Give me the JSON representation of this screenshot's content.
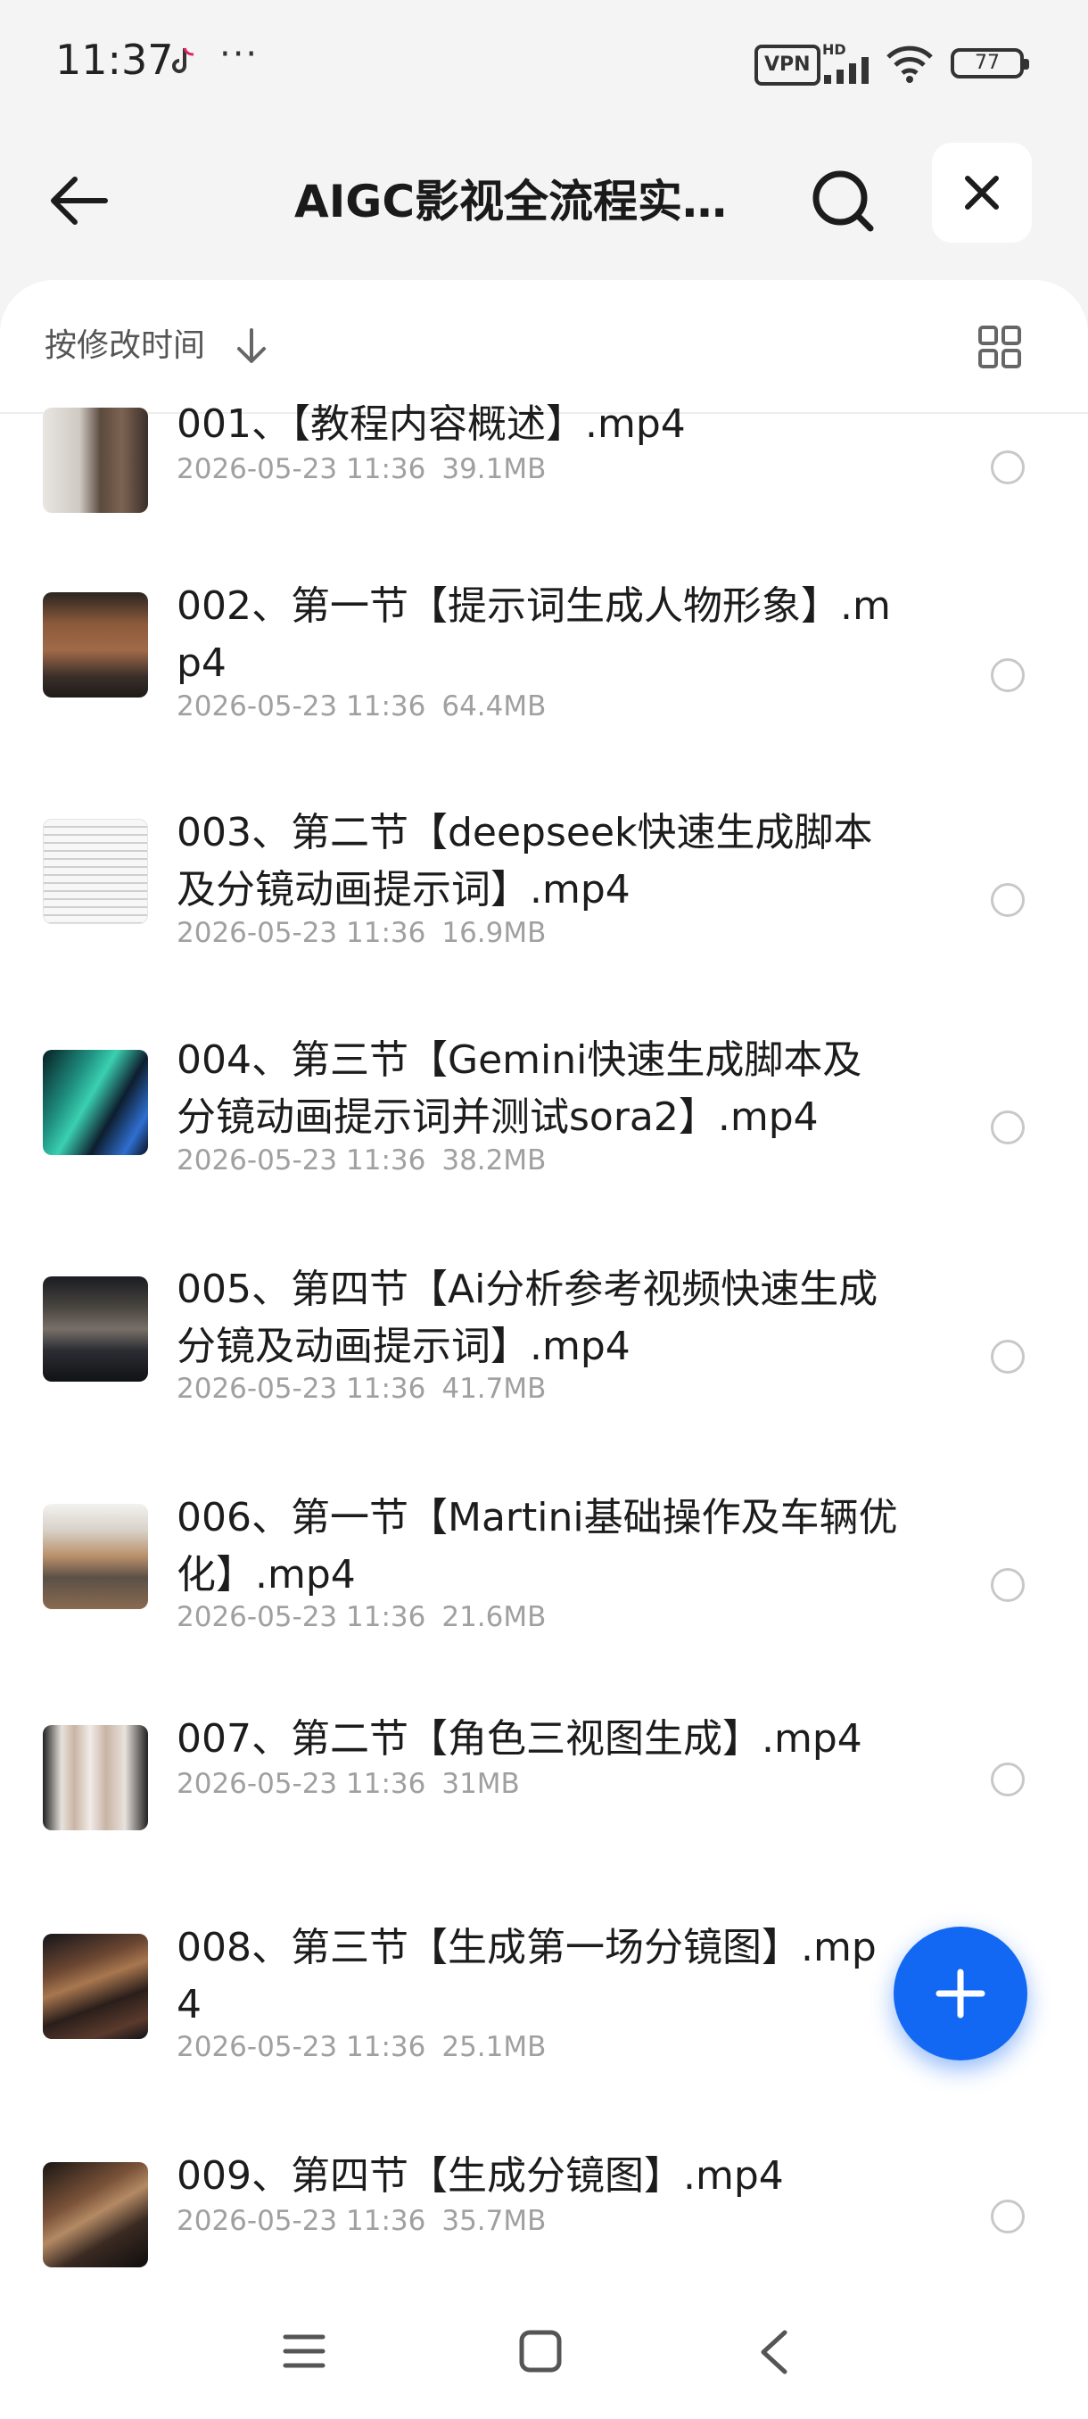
{
  "status_bar": {
    "time": "11:37",
    "more": "···",
    "vpn": "VPN",
    "network": "HD",
    "battery": "77"
  },
  "header": {
    "title": "AIGC影视全流程实…"
  },
  "sort": {
    "label": "按修改时间"
  },
  "files": [
    {
      "name": "001、【教程内容概述】.mp4",
      "date": "2026-05-23 11:36",
      "size": "39.1MB"
    },
    {
      "name": "002、第一节【提示词生成人物形象】.mp4",
      "date": "2026-05-23 11:36",
      "size": "64.4MB"
    },
    {
      "name": "003、第二节【deepseek快速生成脚本及分镜动画提示词】.mp4",
      "date": "2026-05-23 11:36",
      "size": "16.9MB"
    },
    {
      "name": "004、第三节【Gemini快速生成脚本及分镜动画提示词并测试sora2】.mp4",
      "date": "2026-05-23 11:36",
      "size": "38.2MB"
    },
    {
      "name": "005、第四节【Ai分析参考视频快速生成分镜及动画提示词】.mp4",
      "date": "2026-05-23 11:36",
      "size": "41.7MB"
    },
    {
      "name": "006、第一节【Martini基础操作及车辆优化】.mp4",
      "date": "2026-05-23 11:36",
      "size": "21.6MB"
    },
    {
      "name": "007、第二节【角色三视图生成】.mp4",
      "date": "2026-05-23 11:36",
      "size": "31MB"
    },
    {
      "name": "008、第三节【生成第一场分镜图】.mp4",
      "date": "2026-05-23 11:36",
      "size": "25.1MB"
    },
    {
      "name": "009、第四节【生成分镜图】.mp4",
      "date": "2026-05-23 11:36",
      "size": "35.7MB"
    }
  ],
  "colors": {
    "accent": "#1268f3",
    "meta_text": "#a0a0a0",
    "background": "#f4f4f4"
  }
}
